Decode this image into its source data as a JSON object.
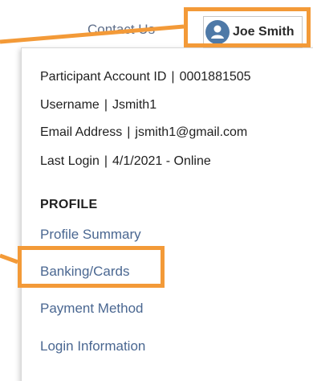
{
  "header": {
    "contact_label": "Contact Us",
    "user_name": "Joe Smith"
  },
  "account": {
    "participant_id_label": "Participant Account ID",
    "participant_id_value": "0001881505",
    "username_label": "Username",
    "username_value": "Jsmith1",
    "email_label": "Email Address",
    "email_value": "jsmith1@gmail.com",
    "last_login_label": "Last Login",
    "last_login_value": "4/1/2021 - Online",
    "separator": "|"
  },
  "profile": {
    "heading": "PROFILE",
    "links": [
      {
        "label": "Profile Summary"
      },
      {
        "label": "Banking/Cards"
      },
      {
        "label": "Payment Method"
      },
      {
        "label": "Login Information"
      }
    ]
  },
  "colors": {
    "highlight": "#f39a38",
    "link": "#4a6791",
    "avatar": "#4e79a7"
  },
  "icons": {
    "avatar": "user-icon"
  }
}
